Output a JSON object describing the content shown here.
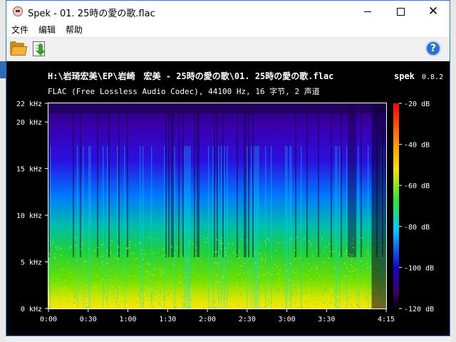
{
  "window": {
    "title": "Spek - 01. 25時の愛の歌.flac"
  },
  "menu": {
    "file": "文件",
    "edit": "编辑",
    "help": "帮助"
  },
  "toolbar": {
    "open_icon": "folder-open-icon",
    "save_icon": "save-image-icon",
    "help_icon": "help-icon",
    "help_glyph": "?"
  },
  "spectrogram": {
    "file_path": "H:\\岩琦宏美\\EP\\岩崎　宏美 - 25時の愛の歌\\01. 25時の愛の歌.flac",
    "app_name": "spek",
    "app_version": "0.8.2",
    "info": "FLAC (Free Lossless Audio Codec), 44100 Hz, 16 字节, 2 声道",
    "freq_ticks": [
      "22 kHz",
      "20 kHz",
      "15 kHz",
      "10 kHz",
      "5 kHz",
      "0 kHz"
    ],
    "freq_values_khz": [
      22,
      20,
      15,
      10,
      5,
      0
    ],
    "time_ticks": [
      "0:00",
      "0:30",
      "1:00",
      "1:30",
      "2:00",
      "2:30",
      "3:00",
      "3:30",
      "4:15"
    ],
    "time_values_s": [
      0,
      30,
      60,
      90,
      120,
      150,
      180,
      210,
      255
    ],
    "db_ticks": [
      "-20 dB",
      "-40 dB",
      "-60 dB",
      "-80 dB",
      "-100 dB",
      "-120 dB"
    ],
    "db_values": [
      -20,
      -40,
      -60,
      -80,
      -100,
      -120
    ],
    "duration_s": 255,
    "max_freq_khz": 22,
    "colors": {
      "hot": "#ff0000",
      "mid": "#00c800",
      "cool": "#00bfff",
      "cold": "#1a00c8",
      "floor": "#000000"
    }
  }
}
